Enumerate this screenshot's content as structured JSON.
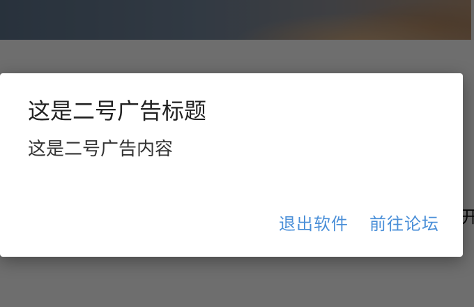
{
  "background": {
    "fragment_text": "开"
  },
  "dialog": {
    "title": "这是二号广告标题",
    "message": "这是二号广告内容",
    "buttons": {
      "exit_label": "退出软件",
      "forum_label": "前往论坛"
    }
  },
  "colors": {
    "accent": "#4a8fd8",
    "title_text": "#212121",
    "overlay": "rgba(0,0,0,0.55)"
  }
}
